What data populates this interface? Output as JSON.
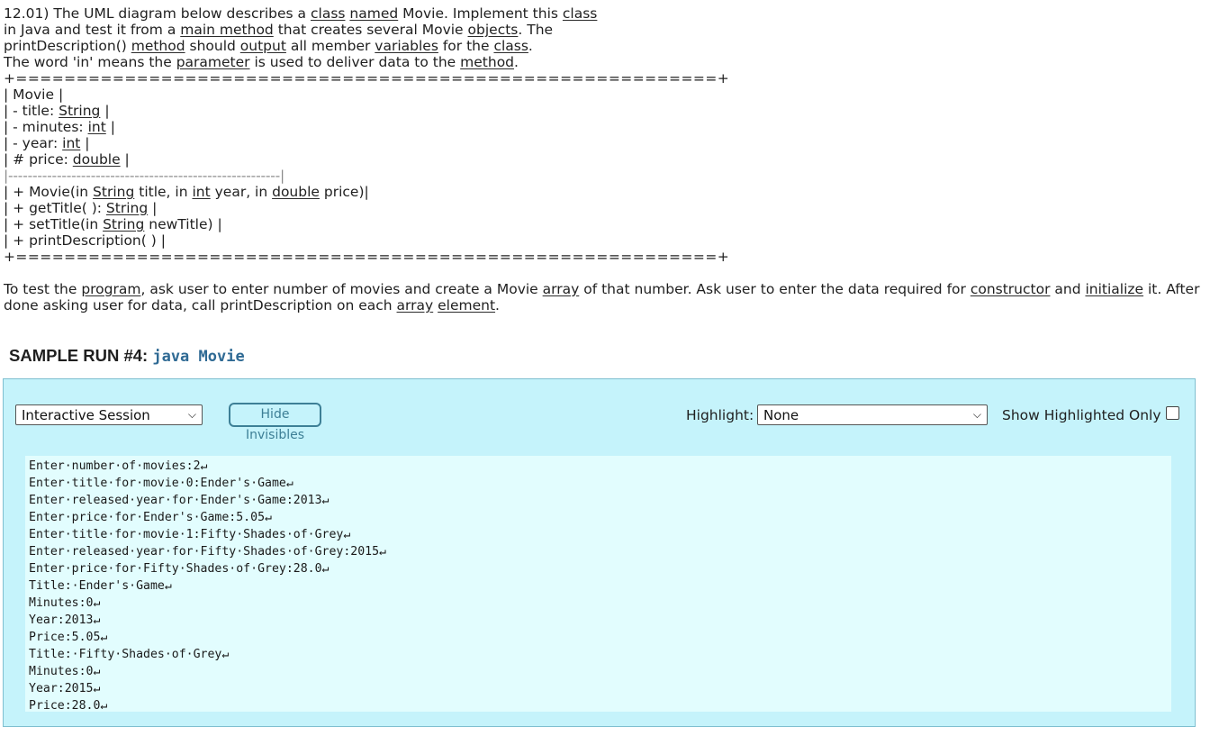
{
  "problem": {
    "intro_lines": [
      [
        {
          "t": "12.01) The UML diagram below describes a "
        },
        {
          "t": "class",
          "u": true
        },
        {
          "t": " "
        },
        {
          "t": "named",
          "u": true
        },
        {
          "t": " Movie. Implement this "
        },
        {
          "t": "class",
          "u": true
        }
      ],
      [
        {
          "t": "in Java and test it from a "
        },
        {
          "t": "main method",
          "u": true
        },
        {
          "t": " that creates several Movie "
        },
        {
          "t": "objects",
          "u": true
        },
        {
          "t": ". The"
        }
      ],
      [
        {
          "t": "printDescription() "
        },
        {
          "t": "method",
          "u": true
        },
        {
          "t": " should "
        },
        {
          "t": "output",
          "u": true
        },
        {
          "t": " all member "
        },
        {
          "t": "variables",
          "u": true
        },
        {
          "t": " for the "
        },
        {
          "t": "class",
          "u": true
        },
        {
          "t": "."
        }
      ],
      [
        {
          "t": "The word 'in' means the "
        },
        {
          "t": "parameter",
          "u": true
        },
        {
          "t": " is used to deliver data to the "
        },
        {
          "t": "method",
          "u": true
        },
        {
          "t": "."
        }
      ]
    ],
    "uml_border": "+==========================================================+",
    "uml_lines": [
      [
        {
          "t": "| Movie |"
        }
      ],
      [
        {
          "t": "| - title: "
        },
        {
          "t": "String",
          "u": true
        },
        {
          "t": " |"
        }
      ],
      [
        {
          "t": "| - minutes: "
        },
        {
          "t": "int",
          "u": true
        },
        {
          "t": " |"
        }
      ],
      [
        {
          "t": "| - year: "
        },
        {
          "t": "int",
          "u": true
        },
        {
          "t": " |"
        }
      ],
      [
        {
          "t": "| # price: "
        },
        {
          "t": "double",
          "u": true
        },
        {
          "t": " |"
        }
      ]
    ],
    "uml_divider": "|--------------------------------------------------------|",
    "uml_method_lines": [
      [
        {
          "t": "| + Movie(in "
        },
        {
          "t": "String",
          "u": true
        },
        {
          "t": " title, in "
        },
        {
          "t": "int",
          "u": true
        },
        {
          "t": " year, in "
        },
        {
          "t": "double",
          "u": true
        },
        {
          "t": " price)|"
        }
      ],
      [
        {
          "t": "| + getTitle( ): "
        },
        {
          "t": "String",
          "u": true
        },
        {
          "t": " |"
        }
      ],
      [
        {
          "t": "| + setTitle(in "
        },
        {
          "t": "String",
          "u": true
        },
        {
          "t": " newTitle) |"
        }
      ],
      [
        {
          "t": "| + printDescription( ) |"
        }
      ]
    ],
    "test_paragraph": [
      {
        "t": "To test the "
      },
      {
        "t": "program",
        "u": true
      },
      {
        "t": ", ask user to enter number of movies and create a Movie "
      },
      {
        "t": "array",
        "u": true
      },
      {
        "t": " of that number. Ask user to enter the data required for "
      },
      {
        "t": "constructor",
        "u": true
      },
      {
        "t": " and "
      },
      {
        "t": "initialize",
        "u": true
      },
      {
        "t": " it. After done asking user for data, call printDescription on each "
      },
      {
        "t": "array",
        "u": true
      },
      {
        "t": " "
      },
      {
        "t": "element",
        "u": true
      },
      {
        "t": "."
      }
    ]
  },
  "sample_run": {
    "label": "SAMPLE RUN #4:",
    "command": "java Movie"
  },
  "panel": {
    "session_select": "Interactive Session",
    "hide_invisibles_button": "Hide Invisibles",
    "highlight_label": "Highlight:",
    "highlight_select": "None",
    "show_highlighted_label": "Show Highlighted Only",
    "show_highlighted_checked": false,
    "output_lines": [
      "Enter·number·of·movies:2↵",
      "Enter·title·for·movie·0:Ender's·Game↵",
      "Enter·released·year·for·Ender's·Game:2013↵",
      "Enter·price·for·Ender's·Game:5.05↵",
      "Enter·title·for·movie·1:Fifty·Shades·of·Grey↵",
      "Enter·released·year·for·Fifty·Shades·of·Grey:2015↵",
      "Enter·price·for·Fifty·Shades·of·Grey:28.0↵",
      "Title:·Ender's·Game↵",
      "Minutes:0↵",
      "Year:2013↵",
      "Price:5.05↵",
      "Title:·Fifty·Shades·of·Grey↵",
      "Minutes:0↵",
      "Year:2015↵",
      "Price:28.0↵"
    ]
  },
  "colors": {
    "panel_bg": "#c5f3fb",
    "output_bg": "#e2fdfe",
    "accent": "#3d7f96",
    "command_text": "#2f6a94"
  }
}
